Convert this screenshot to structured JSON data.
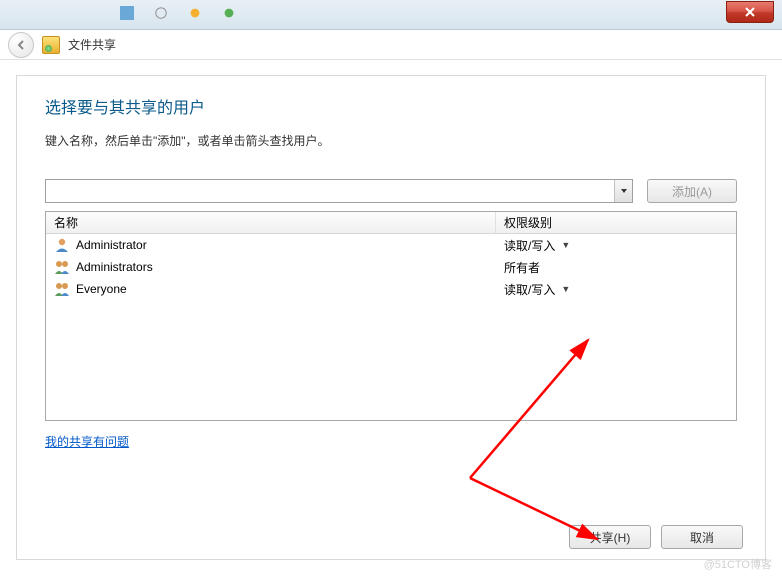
{
  "window": {
    "breadcrumb": "文件共享"
  },
  "dialog": {
    "heading": "选择要与其共享的用户",
    "instruction": "键入名称，然后单击\"添加\"，或者单击箭头查找用户。",
    "combo_placeholder": "",
    "add_button": "添加(A)",
    "help_link": "我的共享有问题"
  },
  "columns": {
    "name": "名称",
    "permission": "权限级别"
  },
  "users": [
    {
      "name": "Administrator",
      "permission": "读取/写入",
      "has_dropdown": true,
      "icon": "single"
    },
    {
      "name": "Administrators",
      "permission": "所有者",
      "has_dropdown": false,
      "icon": "group"
    },
    {
      "name": "Everyone",
      "permission": "读取/写入",
      "has_dropdown": true,
      "icon": "group"
    }
  ],
  "footer": {
    "share": "共享(H)",
    "cancel": "取消"
  },
  "watermark": "@51CTO博客"
}
